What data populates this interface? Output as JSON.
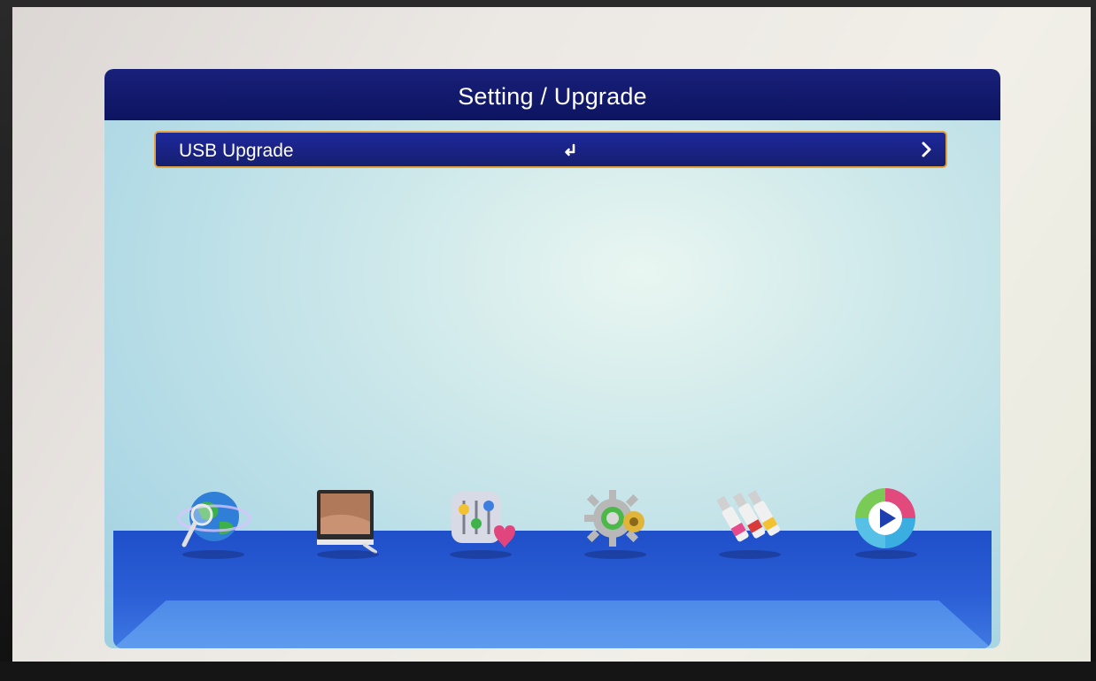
{
  "window": {
    "title": "Setting / Upgrade"
  },
  "menu": {
    "items": [
      {
        "label": "USB Upgrade",
        "enter_icon": "enter-return-icon",
        "arrow_icon": "chevron-right-icon"
      }
    ]
  },
  "bottom_nav": {
    "icons": [
      "globe-search-icon",
      "monitor-tv-icon",
      "equalizer-heart-icon",
      "gear-settings-icon",
      "av-cable-plugs-icon",
      "media-play-icon"
    ]
  },
  "colors": {
    "title_bar": "#0d1460",
    "highlight_border": "#e6a33b",
    "selected_row": "#1a2286",
    "panel_background": "#b3dbe6",
    "shelf": "#2b5fd6"
  }
}
